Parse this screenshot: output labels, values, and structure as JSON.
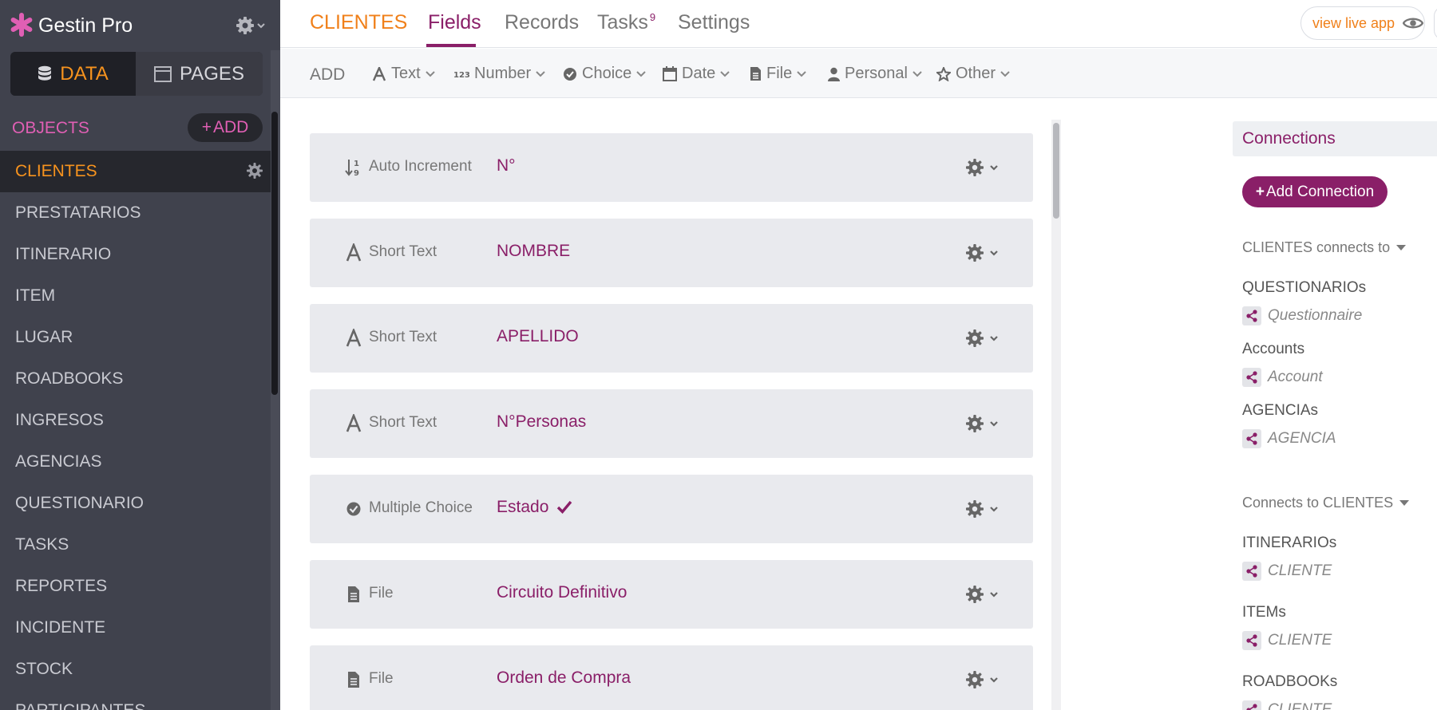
{
  "app": {
    "name": "Gestin Pro"
  },
  "sidebar": {
    "segments": {
      "data": "DATA",
      "pages": "PAGES"
    },
    "objects_label": "OBJECTS",
    "add_label": "ADD",
    "items": [
      {
        "label": "CLIENTES",
        "active": true
      },
      {
        "label": "PRESTATARIOS"
      },
      {
        "label": "ITINERARIO"
      },
      {
        "label": "ITEM"
      },
      {
        "label": "LUGAR"
      },
      {
        "label": "ROADBOOKS"
      },
      {
        "label": "INGRESOS"
      },
      {
        "label": "AGENCIAS"
      },
      {
        "label": "QUESTIONARIO"
      },
      {
        "label": "TASKS"
      },
      {
        "label": "REPORTES"
      },
      {
        "label": "INCIDENTE"
      },
      {
        "label": "STOCK"
      },
      {
        "label": "PARTICIPANTES"
      }
    ]
  },
  "topnav": {
    "object_title": "CLIENTES",
    "tabs": [
      {
        "label": "Fields",
        "active": true
      },
      {
        "label": "Records"
      },
      {
        "label": "Tasks",
        "badge": "9"
      },
      {
        "label": "Settings"
      }
    ],
    "live_app_label": "view live app"
  },
  "toolbar": {
    "add_label": "ADD",
    "types": [
      {
        "label": "Text",
        "icon": "text-icon"
      },
      {
        "label": "Number",
        "icon": "number-icon"
      },
      {
        "label": "Choice",
        "icon": "choice-icon"
      },
      {
        "label": "Date",
        "icon": "calendar-icon"
      },
      {
        "label": "File",
        "icon": "file-icon"
      },
      {
        "label": "Personal",
        "icon": "person-icon"
      },
      {
        "label": "Other",
        "icon": "star-icon"
      }
    ]
  },
  "fields": [
    {
      "type": "Auto Increment",
      "name": "N°",
      "icon": "sort-numeric-icon"
    },
    {
      "type": "Short Text",
      "name": "NOMBRE",
      "icon": "text-icon"
    },
    {
      "type": "Short Text",
      "name": "APELLIDO",
      "icon": "text-icon"
    },
    {
      "type": "Short Text",
      "name": "N°Personas",
      "icon": "text-icon"
    },
    {
      "type": "Multiple Choice",
      "name": "Estado",
      "icon": "choice-icon",
      "display_field": true
    },
    {
      "type": "File",
      "name": "Circuito Definitivo",
      "icon": "file-icon"
    },
    {
      "type": "File",
      "name": "Orden de Compra",
      "icon": "file-icon"
    }
  ],
  "connections": {
    "title": "Connections",
    "add_button": "Add Connection",
    "outgoing_label": "CLIENTES connects to",
    "outgoing": [
      {
        "object": "QUESTIONARIOs",
        "field": "Questionnaire"
      },
      {
        "object": "Accounts",
        "field": "Account"
      },
      {
        "object": "AGENCIAs",
        "field": "AGENCIA"
      }
    ],
    "incoming_label": "Connects to CLIENTES",
    "incoming": [
      {
        "object": "ITINERARIOs",
        "field": "CLIENTE"
      },
      {
        "object": "ITEMs",
        "field": "CLIENTE"
      },
      {
        "object": "ROADBOOKs",
        "field": "CLIENTE"
      }
    ]
  },
  "colors": {
    "accent": "#8a1f68",
    "orange": "#f0801a",
    "pink": "#e05fb4",
    "sidebar": "#40424d"
  }
}
